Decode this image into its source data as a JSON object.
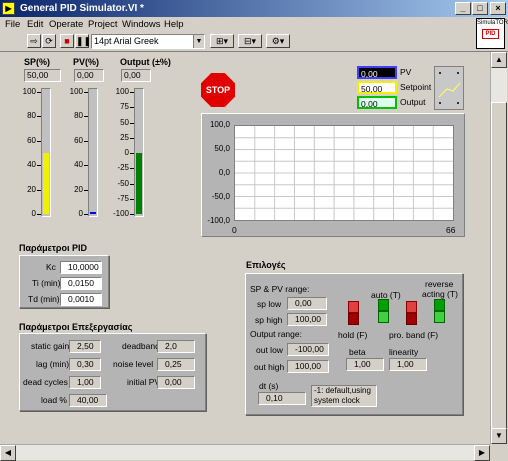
{
  "window": {
    "title": "General PID Simulator.VI *"
  },
  "menu": [
    "File",
    "Edit",
    "Operate",
    "Project",
    "Windows",
    "Help"
  ],
  "toolbar": {
    "font": "14pt Arial Greek"
  },
  "vi_icon": {
    "line1": "SimulaTOR",
    "line2": "PID"
  },
  "indicators": {
    "sp": {
      "label": "SP(%)",
      "value": "50,00",
      "level": 50,
      "color": "#f0f000"
    },
    "pv": {
      "label": "PV(%)",
      "value": "0,00",
      "level": 0,
      "color": "#0000ff"
    },
    "output": {
      "label": "Output (±%)",
      "value": "0,00",
      "level": 50,
      "color": "#008000"
    }
  },
  "scale_0_100": [
    "100",
    "80",
    "60",
    "40",
    "20",
    "0"
  ],
  "scale_output": [
    "100",
    "75",
    "50",
    "25",
    "0",
    "-25",
    "-50",
    "-75",
    "-100"
  ],
  "stop_label": "STOP",
  "legend": [
    {
      "value": "0,00",
      "name": "PV",
      "color": "#0000ff"
    },
    {
      "value": "50,00",
      "name": "Setpoint",
      "color": "#f0f000"
    },
    {
      "value": "0,00",
      "name": "Output",
      "color": "#00c000"
    }
  ],
  "chart": {
    "y_ticks": [
      "100,0",
      "50,0",
      "0,0",
      "-50,0",
      "-100,0"
    ],
    "x_min": "0",
    "x_max": "66"
  },
  "pid_params": {
    "title": "Παράμετροι PID",
    "kc": {
      "label": "Kc",
      "value": "10,0000"
    },
    "ti": {
      "label": "Ti (min)",
      "value": "0,0150"
    },
    "td": {
      "label": "Td (min)",
      "value": "0,0010"
    }
  },
  "process_params": {
    "title": "Παράμετροι Επεξεργασίας",
    "static_gain": {
      "label": "static gain",
      "value": "2,50"
    },
    "lag": {
      "label": "lag (min)",
      "value": "0,30"
    },
    "dead_cycles": {
      "label": "dead cycles",
      "value": "1,00"
    },
    "load": {
      "label": "load %",
      "value": "40,00"
    },
    "deadband": {
      "label": "deadband",
      "value": "2,0"
    },
    "noise": {
      "label": "noise level",
      "value": "0,25"
    },
    "initial_pv": {
      "label": "initial PV",
      "value": "0,00"
    }
  },
  "options": {
    "title": "Επιλογές",
    "sp_pv_range": "SP & PV range:",
    "sp_low": {
      "label": "sp low",
      "value": "0,00"
    },
    "sp_high": {
      "label": "sp high",
      "value": "100,00"
    },
    "output_range": "Output range:",
    "out_low": {
      "label": "out low",
      "value": "-100,00"
    },
    "out_high": {
      "label": "out high",
      "value": "100,00"
    },
    "auto": "auto (T)",
    "hold": "hold (F)",
    "reverse_line1": "reverse",
    "reverse_line2": "acting (T)",
    "pro_band": "pro. band (F)",
    "beta": {
      "label": "beta",
      "value": "1,00"
    },
    "linearity": {
      "label": "linearity",
      "value": "1,00"
    },
    "dt": {
      "label": "dt (s)",
      "value": "0,10"
    },
    "dt_note": "-1: default,using system clock"
  }
}
